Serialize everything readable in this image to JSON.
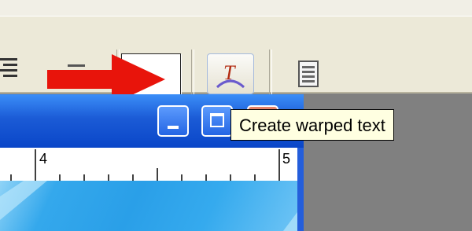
{
  "ruler": {
    "labels": [
      "4",
      "5"
    ]
  },
  "tooltip": {
    "text": "Create warped text"
  },
  "colors": {
    "toolbar_bg": "#ece9d8",
    "titlebar_blue": "#245edb",
    "arrow_red": "#e8140b",
    "tooltip_bg": "#ffffe1",
    "close_red": "#c8442a"
  },
  "icons": {
    "align": "align-text-icon",
    "warp": "warp-text-icon",
    "doc": "paragraph-panel-icon",
    "minimize": "minimize-icon",
    "maximize": "maximize-icon",
    "close": "close-icon"
  }
}
